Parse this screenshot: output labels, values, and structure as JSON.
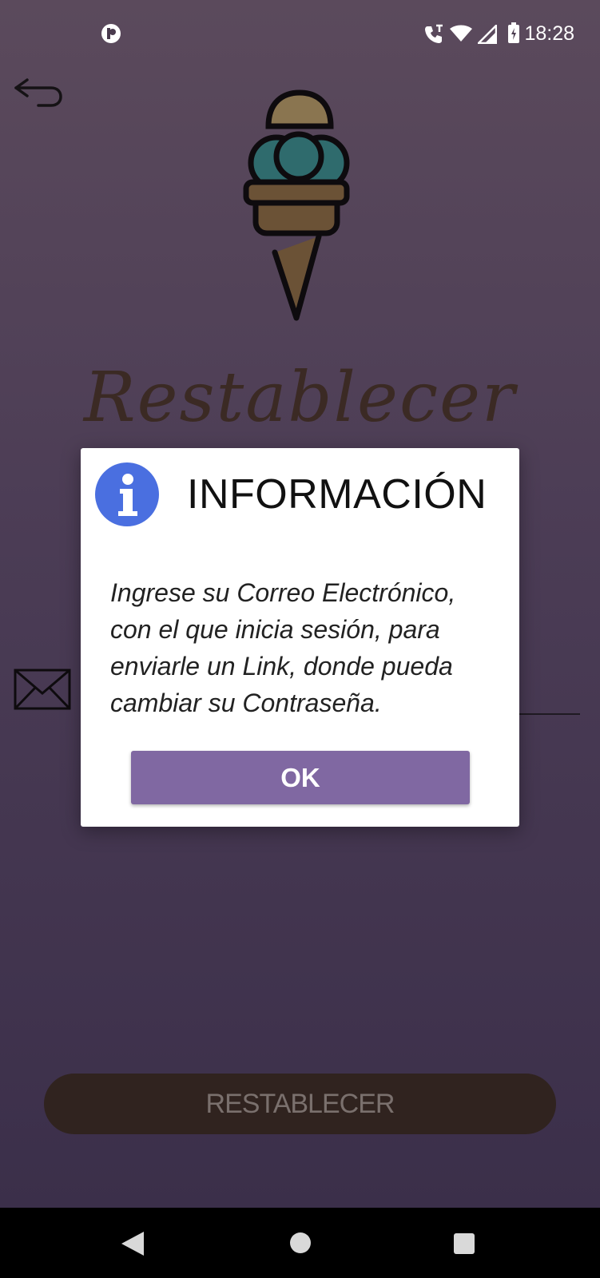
{
  "status_bar": {
    "time": "18:28"
  },
  "screen": {
    "title": "Restablecer",
    "reset_button_label": "RESTABLECER"
  },
  "dialog": {
    "title": "INFORMACIÓN",
    "message": "Ingrese su Correo Electrónico, con el que inicia sesión, para enviarle un Link, donde pueda cambiar su Contraseña.",
    "ok_label": "OK"
  },
  "colors": {
    "background_top": "#5b4a5c",
    "background_bottom": "#3b2f4a",
    "ok_button": "#8068a2",
    "reset_button": "#30231f",
    "info_icon": "#4a6fe0"
  },
  "icons": [
    "app-badge-icon",
    "call-icon",
    "wifi-icon",
    "signal-icon",
    "battery-icon",
    "back-arrow-icon",
    "ice-cream-logo-icon",
    "email-icon",
    "info-icon",
    "nav-back-icon",
    "nav-home-icon",
    "nav-recents-icon"
  ]
}
